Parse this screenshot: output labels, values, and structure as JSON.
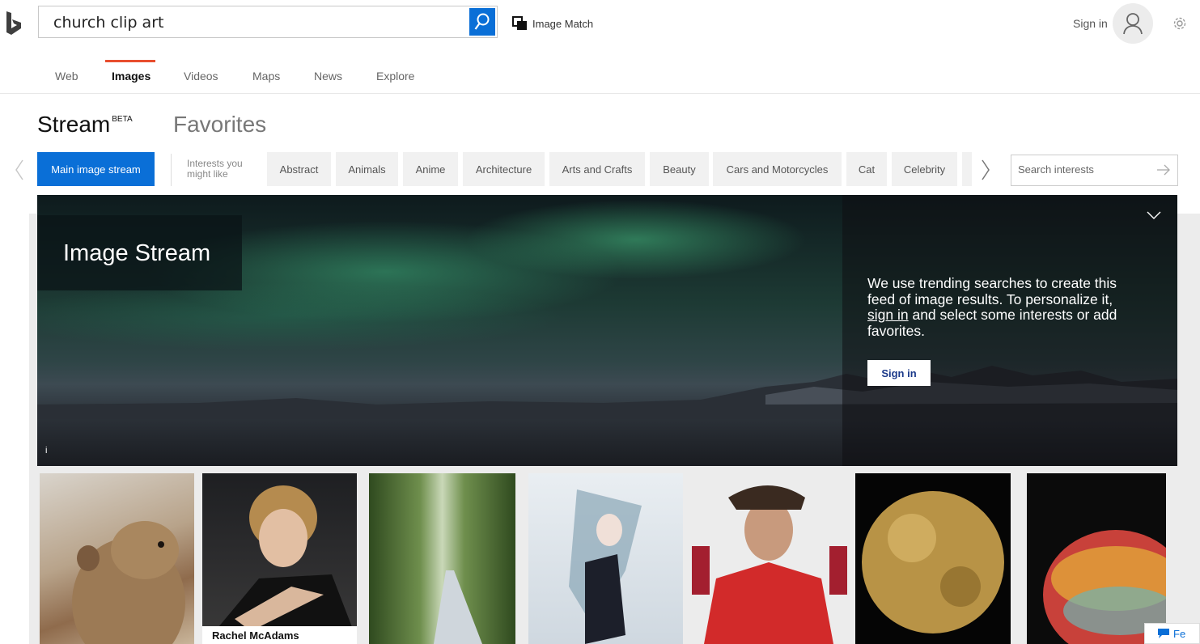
{
  "search": {
    "query": "church clip art"
  },
  "header": {
    "image_match_label": "Image Match",
    "sign_in_label": "Sign in"
  },
  "nav": {
    "items": [
      {
        "label": "Web"
      },
      {
        "label": "Images",
        "active": true
      },
      {
        "label": "Videos"
      },
      {
        "label": "Maps"
      },
      {
        "label": "News"
      },
      {
        "label": "Explore"
      }
    ]
  },
  "stream": {
    "title": "Stream",
    "badge": "BETA",
    "favorites_label": "Favorites"
  },
  "interests": {
    "main_label": "Main image stream",
    "label_line1": "Interests you",
    "label_line2": "might like",
    "chips": [
      "Abstract",
      "Animals",
      "Anime",
      "Architecture",
      "Arts and Crafts",
      "Beauty",
      "Cars and Motorcycles",
      "Cat",
      "Celebrity"
    ],
    "search_placeholder": "Search interests"
  },
  "hero": {
    "title": "Image Stream",
    "text_before_link": "We use trending searches to create this feed of image results. To personalize it, ",
    "link_text": "sign in",
    "text_after_link": " and select some interests or add favorites.",
    "sign_in_button": "Sign in",
    "info_label": "i"
  },
  "thumbnails": [
    {
      "subject": "prairie-dog"
    },
    {
      "subject": "woman-portrait",
      "caption": "Rachel McAdams"
    },
    {
      "subject": "bamboo-path"
    },
    {
      "subject": "anime-girl"
    },
    {
      "subject": "footballer"
    },
    {
      "subject": "planet-io"
    },
    {
      "subject": "abstract-sphere"
    }
  ],
  "feedback": {
    "label": "Fe"
  },
  "colors": {
    "accent": "#0a6fd7",
    "nav_underline": "#e84e2e"
  }
}
